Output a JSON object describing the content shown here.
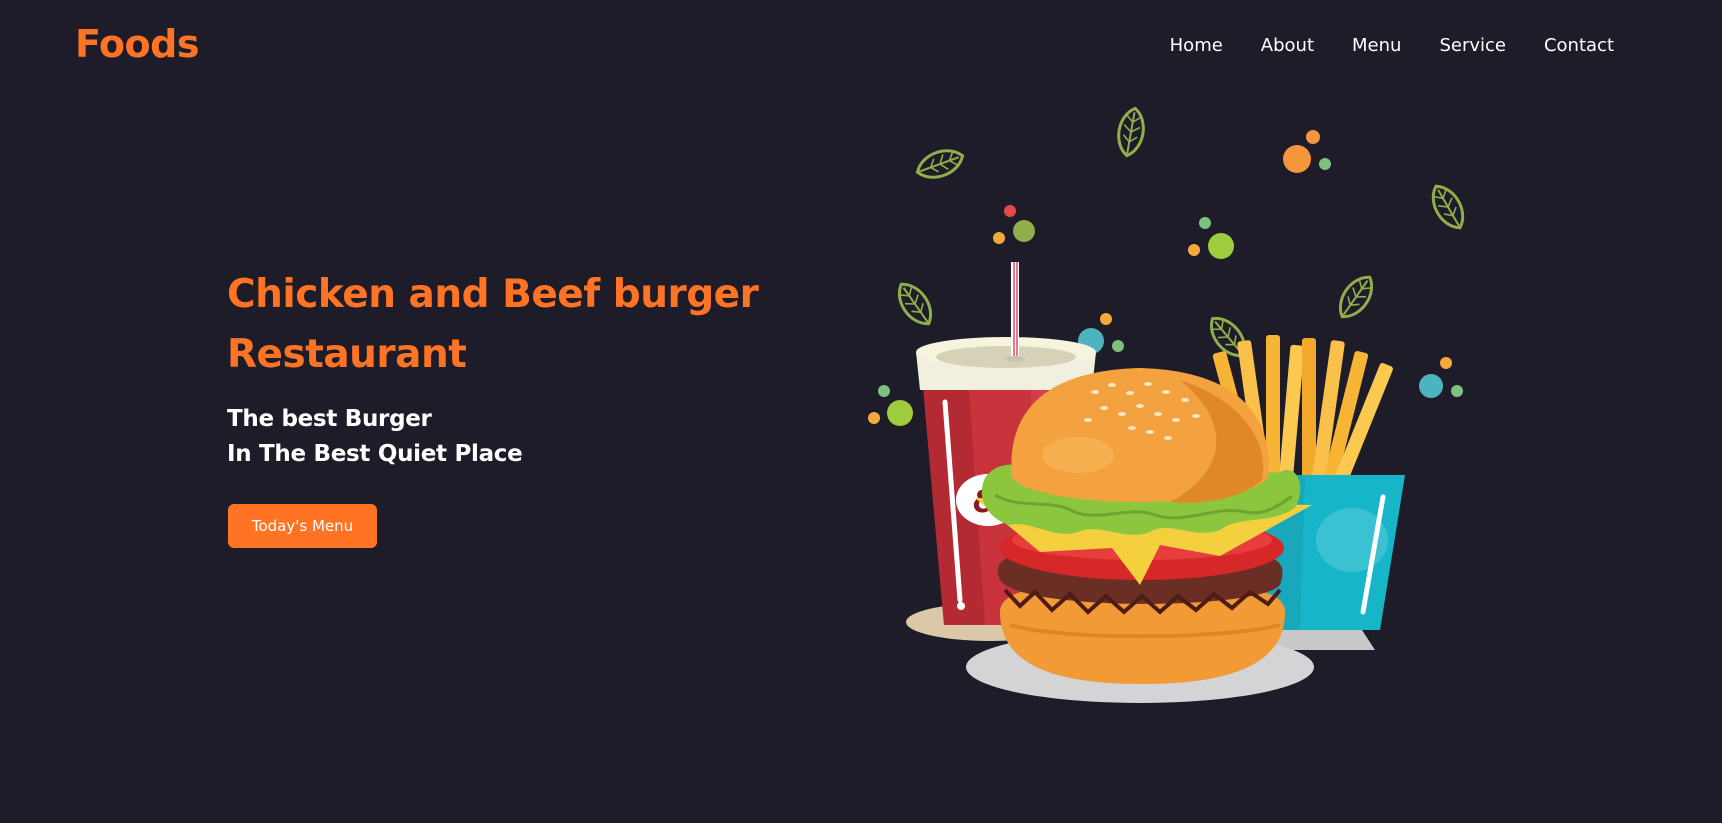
{
  "header": {
    "brand": "Foods",
    "nav": [
      "Home",
      "About",
      "Menu",
      "Service",
      "Contact"
    ]
  },
  "hero": {
    "title": "Chicken and Beef burger Restaurant",
    "subtitle_line1": "The best Burger",
    "subtitle_line2": "In The Best Quiet Place",
    "button_label": "Today's Menu"
  },
  "illustration": {
    "cup_logo_text": "&"
  },
  "colors": {
    "background": "#1e1c29",
    "accent": "#ff7324",
    "text": "#ffffff"
  }
}
